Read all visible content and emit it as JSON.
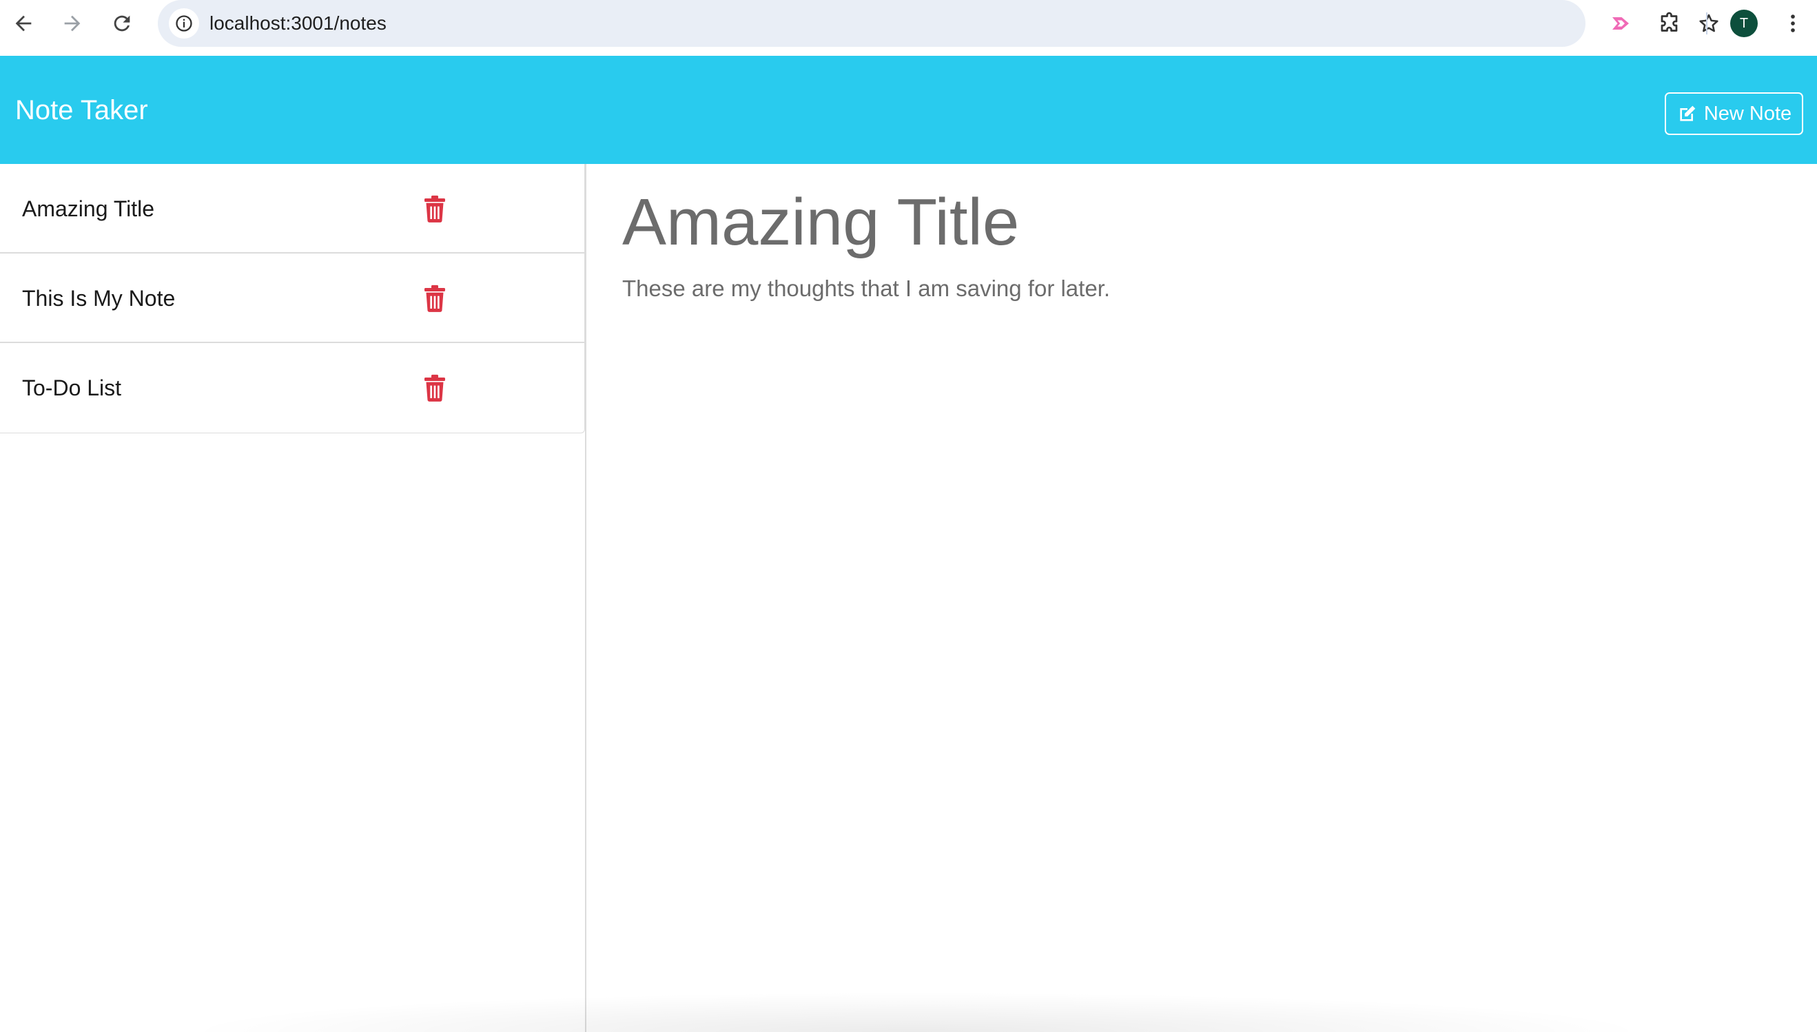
{
  "browser": {
    "url": "localhost:3001/notes",
    "profile_initial": "T",
    "icons": {
      "back": "arrow-left-icon",
      "forward": "arrow-right-icon",
      "reload": "reload-icon",
      "site_info": "info-icon",
      "bookmark": "star-icon",
      "extension": "pink-arrow-extension-icon",
      "extensions_menu": "puzzle-icon",
      "menu": "kebab-menu-icon"
    }
  },
  "navbar": {
    "brand": "Note Taker",
    "new_note_label": "New Note",
    "new_note_icon": "edit-icon",
    "background_color": "#29cbee"
  },
  "notes": [
    {
      "title": "Amazing Title",
      "delete_icon": "trash-icon"
    },
    {
      "title": "This Is My Note",
      "delete_icon": "trash-icon"
    },
    {
      "title": "To-Do List",
      "delete_icon": "trash-icon"
    }
  ],
  "active_note": {
    "title": "Amazing Title",
    "text": "These are my thoughts that I am saving for later."
  },
  "colors": {
    "delete": "#dc3545",
    "text_muted": "#6c6c6c"
  }
}
